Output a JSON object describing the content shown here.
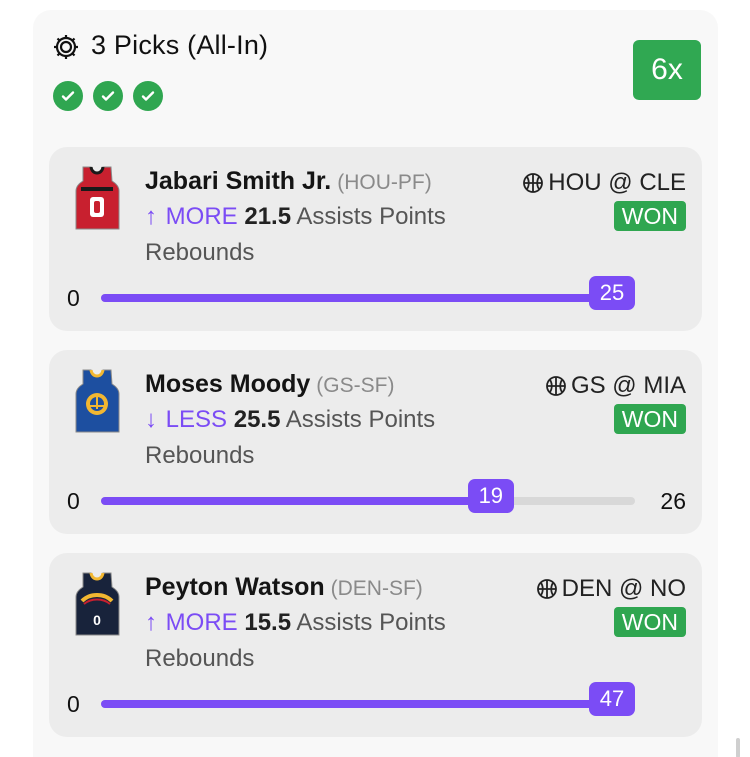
{
  "header": {
    "title": "3 Picks (All-In)",
    "multiplier": "6x",
    "check_count": 3
  },
  "picks": [
    {
      "player": "Jabari Smith Jr.",
      "team_pos": "(HOU-PF)",
      "matchup": "HOU @ CLE",
      "result": "WON",
      "direction": "MORE",
      "arrow": "↑",
      "line": "21.5",
      "stat": "Assists Points Rebounds",
      "bar_min": "0",
      "bar_max": "",
      "actual": "25",
      "progress": 1.0,
      "jersey": {
        "icon": "rockets-jersey-icon",
        "primary": "#c8202f",
        "trim": "#1a1a1a",
        "number": "0"
      }
    },
    {
      "player": "Moses Moody",
      "team_pos": "(GS-SF)",
      "matchup": "GS @ MIA",
      "result": "WON",
      "direction": "LESS",
      "arrow": "↓",
      "line": "25.5",
      "stat": "Assists Points Rebounds",
      "bar_min": "0",
      "bar_max": "26",
      "actual": "19",
      "progress": 0.73,
      "jersey": {
        "icon": "warriors-jersey-icon",
        "primary": "#1d4fa0",
        "trim": "#f2b731",
        "number": ""
      }
    },
    {
      "player": "Peyton Watson",
      "team_pos": "(DEN-SF)",
      "matchup": "DEN @ NO",
      "result": "WON",
      "direction": "MORE",
      "arrow": "↑",
      "line": "15.5",
      "stat": "Assists Points Rebounds",
      "bar_min": "0",
      "bar_max": "",
      "actual": "47",
      "progress": 1.0,
      "jersey": {
        "icon": "nuggets-jersey-icon",
        "primary": "#18233b",
        "trim": "#f2b731",
        "number": "0"
      }
    }
  ],
  "colors": {
    "accent": "#7b4cf5",
    "won": "#2fa650",
    "multiplier_bg": "#30a852"
  }
}
